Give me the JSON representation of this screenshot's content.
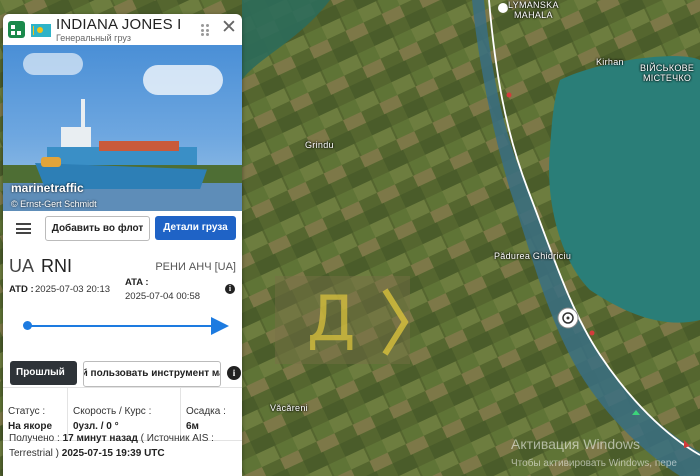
{
  "map": {
    "labels": {
      "lymanska": "LYMANSKA\nMAHALA",
      "kirhan": "Kirhan",
      "viiskove": "ВІЙСЬКОВЕ\nМІСТЕЧКО",
      "grindu": "Grindu",
      "padurea": "Pădurea Ghidriciu",
      "vacareni": "Văcăreni"
    },
    "watermark_letter": "Д",
    "windows_activation": {
      "title": "Активация Windows",
      "subtitle": "Чтобы активировать Windows, пере"
    },
    "colors": {
      "lake": "#2a7e78",
      "route": "#ffffff",
      "fields": "#6b7f3e"
    }
  },
  "vessel": {
    "name": "INDIANA JONES I",
    "type": "Генеральный груз",
    "photo": {
      "brand": "marinetraffic",
      "credit": "© Ernst-Gert Schmidt"
    }
  },
  "actions": {
    "add_to_fleet": "Добавить во флот",
    "cargo_details": "Детали груза"
  },
  "route": {
    "country_code": "UA",
    "locode": "RNI",
    "port_name": "РЕНИ АНЧ [UA]",
    "atd_label": "ATD :",
    "atd_value": "2025-07-03 20:13",
    "ata_label": "ATA :",
    "ata_value": "2025-07-04 00:58",
    "past_button": "Прошлый",
    "tool_button": "Прошлый пользовать инструмент маршрута"
  },
  "stats": {
    "status_label": "Статус :",
    "status_value": "На якоре",
    "speed_label": "Скорость / Курс :",
    "speed_value": "0узл. / 0 °",
    "draught_label": "Осадка :",
    "draught_value": "6м"
  },
  "received": {
    "prefix": "Получено : ",
    "ago": "17 минут назад",
    "source_prefix": " ( Источник AIS : ",
    "source": "Terrestrial",
    "suffix": " ) ",
    "timestamp": "2025-07-15 19:39 UTC"
  }
}
